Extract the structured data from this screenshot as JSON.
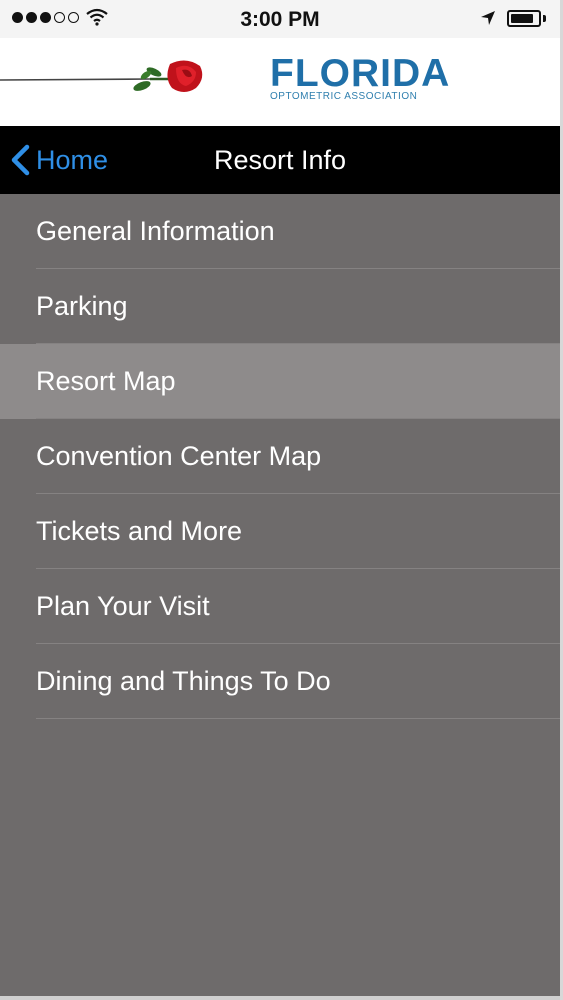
{
  "status_bar": {
    "signal_dots_filled": 3,
    "signal_dots_total": 5,
    "time": "3:00 PM",
    "wifi_icon": "wifi-icon",
    "location_icon": "location-arrow-icon",
    "battery_level": 0.85
  },
  "banner": {
    "logo_title": "FLORIDA",
    "logo_subtitle": "OPTOMETRIC ASSOCIATION",
    "rose_icon": "rose-icon",
    "brand_color": "#1f6fa8"
  },
  "nav": {
    "back_label": "Home",
    "title": "Resort Info",
    "back_icon": "chevron-left-icon",
    "accent_color": "#2f8fe6"
  },
  "menu": {
    "items": [
      {
        "label": "General Information",
        "selected": false
      },
      {
        "label": "Parking",
        "selected": false
      },
      {
        "label": "Resort Map",
        "selected": true
      },
      {
        "label": "Convention Center Map",
        "selected": false
      },
      {
        "label": "Tickets and More",
        "selected": false
      },
      {
        "label": "Plan Your Visit",
        "selected": false
      },
      {
        "label": "Dining and Things To Do",
        "selected": false
      }
    ]
  }
}
